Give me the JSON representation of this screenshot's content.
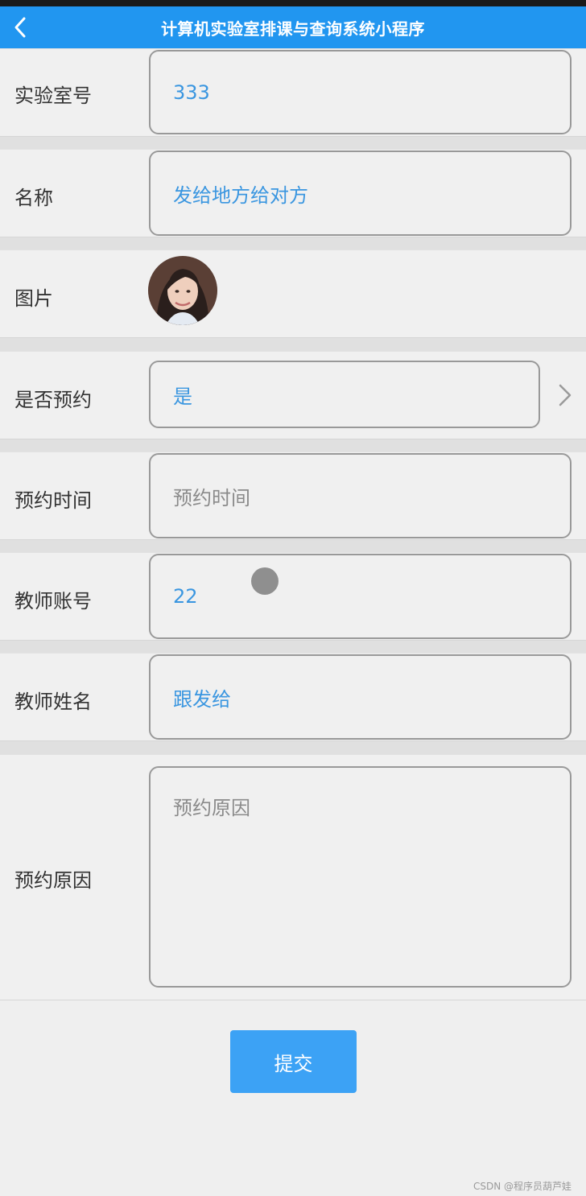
{
  "app": {
    "title": "计算机实验室排课与查询系统小程序",
    "back_icon": "chevron-left-icon"
  },
  "form": {
    "lab_no": {
      "label": "实验室号",
      "value": "333"
    },
    "name": {
      "label": "名称",
      "value": "发给地方给对方"
    },
    "image": {
      "label": "图片",
      "alt": "avatar-photo"
    },
    "reserved": {
      "label": "是否预约",
      "value": "是",
      "chevron_icon": "chevron-right-icon"
    },
    "reserve_time": {
      "label": "预约时间",
      "placeholder": "预约时间"
    },
    "teacher_account": {
      "label": "教师账号",
      "value": "22"
    },
    "teacher_name": {
      "label": "教师姓名",
      "value": "跟发给"
    },
    "reason": {
      "label": "预约原因",
      "placeholder": "预约原因"
    }
  },
  "actions": {
    "submit_label": "提交"
  },
  "watermark": "CSDN @程序员葫芦娃",
  "colors": {
    "navbar": "#2196f0",
    "value_text": "#3a96e0",
    "submit": "#3ca2f5"
  }
}
